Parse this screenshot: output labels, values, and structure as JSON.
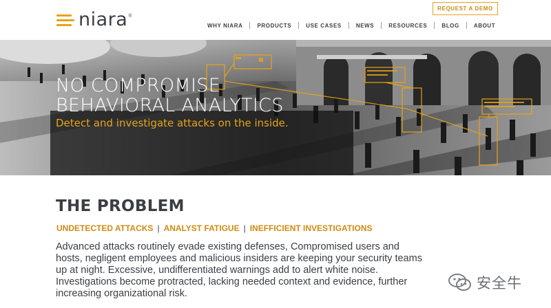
{
  "brand": {
    "name": "niara",
    "reg": "®",
    "accent": "#e8a317"
  },
  "header": {
    "cta": "REQUEST A DEMO",
    "nav": [
      "WHY NIARA",
      "PRODUCTS",
      "USE CASES",
      "NEWS",
      "RESOURCES",
      "BLOG",
      "ABOUT"
    ]
  },
  "hero": {
    "title_line1": "NO COMPROMISE",
    "title_line2": "BEHAVIORAL ANALYTICS",
    "subtitle": "Detect and investigate attacks on the inside."
  },
  "problem": {
    "title": "THE PROBLEM",
    "tags": [
      "UNDETECTED ATTACKS",
      "ANALYST FATIGUE",
      "INEFFICIENT INVESTIGATIONS"
    ],
    "tag_separator": "|",
    "body": "Advanced attacks routinely evade existing defenses, Compromised users and hosts, negligent employees and malicious insiders are keeping your security teams up at night. Excessive, undifferentiated warnings add to alert white noise. Investigations become protracted, lacking needed context and evidence, further increasing organizational risk."
  },
  "watermark": {
    "text": "安全牛",
    "icon": "wechat-icon"
  }
}
